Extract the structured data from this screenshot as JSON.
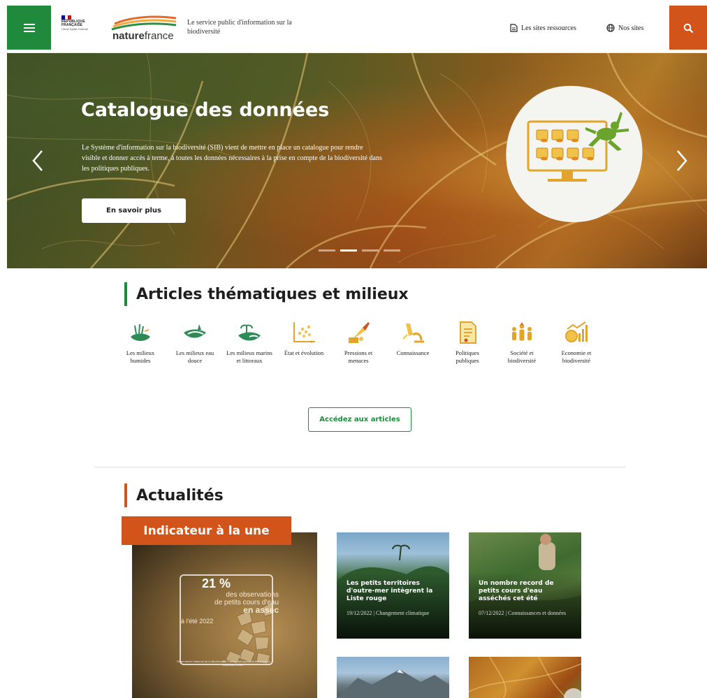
{
  "header": {
    "republique": "RÉPUBLIQUE FRANÇAISE",
    "devise": "Liberté Égalité Fraternité",
    "logo_word_bold": "nature",
    "logo_word_light": "france",
    "tagline": "Le service public d'information sur la biodiversité",
    "link_ressources": "Les sites ressources",
    "link_sites": "Nos sites",
    "colors": {
      "green": "#1f8a3c",
      "orange": "#d2541b"
    }
  },
  "hero": {
    "title": "Catalogue des données",
    "description": "Le Système d'information sur la biodiversité (SIB) vient de mettre en place un catalogue pour rendre visible et donner accès à terme, à toutes les données nécessaires à la prise en compte de la biodiversité dans les politiques publiques.",
    "cta": "En savoir plus",
    "slides": 4,
    "active_slide": 2
  },
  "articles": {
    "title": "Articles thématiques et milieux",
    "themes": [
      {
        "label": "Les milieux humides",
        "icon": "wetland-icon"
      },
      {
        "label": "Les milieux eau douce",
        "icon": "freshwater-icon"
      },
      {
        "label": "Les milieux marins et littoraux",
        "icon": "coastal-icon"
      },
      {
        "label": "État et évolution",
        "icon": "trend-chart-icon"
      },
      {
        "label": "Pressions et menaces",
        "icon": "threat-icon"
      },
      {
        "label": "Connaissance",
        "icon": "microscope-icon"
      },
      {
        "label": "Politiques publiques",
        "icon": "document-icon"
      },
      {
        "label": "Société et biodiversité",
        "icon": "people-icon"
      },
      {
        "label": "Economie et biodiversité",
        "icon": "economy-icon"
      }
    ],
    "cta": "Accédez aux articles"
  },
  "news": {
    "title": "Actualités",
    "featured_label": "Indicateur à la une",
    "featured": {
      "percent": "21 %",
      "line1": "des observations",
      "line2": "de petits cours d'eau",
      "line3": "en assec",
      "line4": "à l'été 2022",
      "footer_left": "Observatoire National de la Biodiversité",
      "footer_right": "En France métropolitaine entre mai et septembre 2022"
    },
    "items": [
      {
        "title": "Les petits territoires d'outre-mer intègrent la Liste rouge",
        "meta": "19/12/2022 | Changement climatique"
      },
      {
        "title": "Un nombre record de petits cours d'eau asséchés cet été",
        "meta": "07/12/2022 | Connaissances et données"
      }
    ]
  }
}
